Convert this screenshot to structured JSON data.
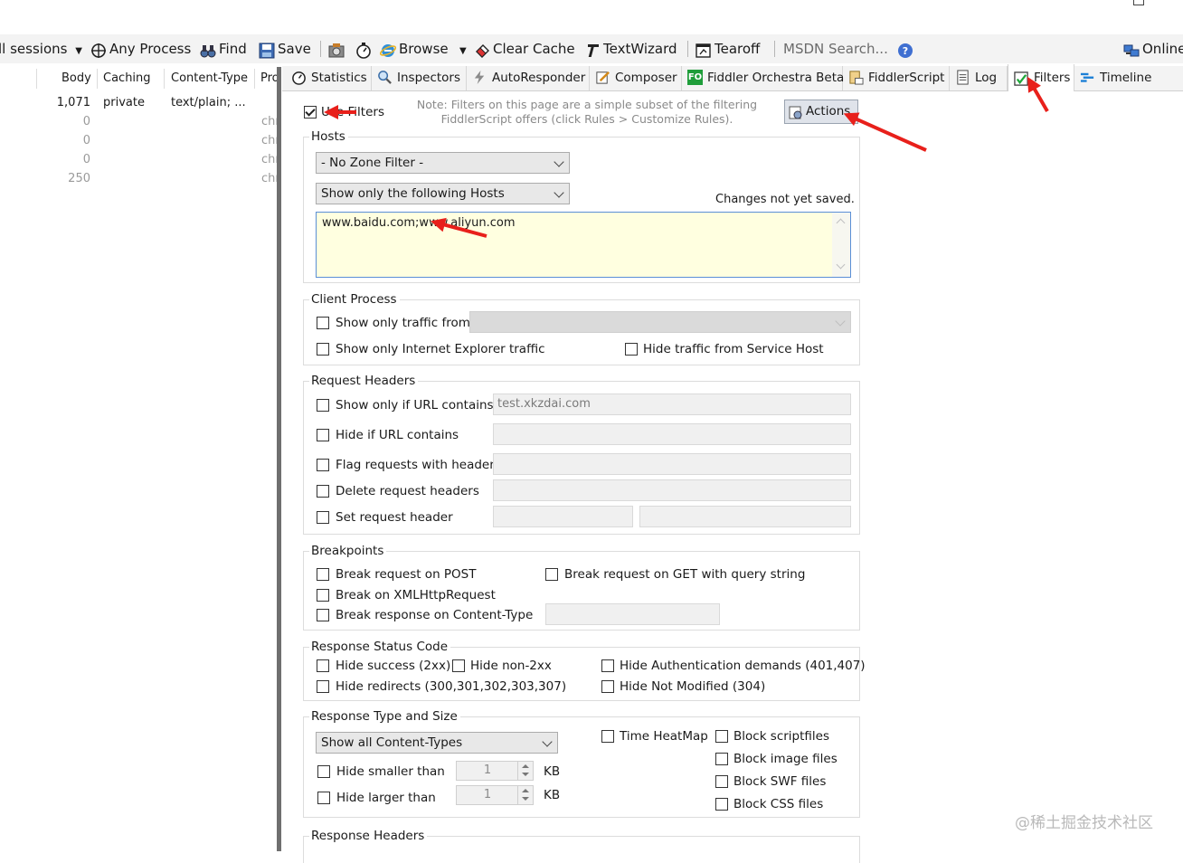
{
  "toolbar": {
    "sessions_label": "ll sessions",
    "any_process": "Any Process",
    "find": "Find",
    "save": "Save",
    "browse": "Browse",
    "clear_cache": "Clear Cache",
    "text_wizard": "TextWizard",
    "tearoff": "Tearoff",
    "msdn_search": "MSDN Search...",
    "online": "Online"
  },
  "sessions": {
    "columns": [
      "Body",
      "Caching",
      "Content-Type",
      "Pro"
    ],
    "rows": [
      {
        "body": "1,071",
        "caching": "private",
        "content_type": "text/plain; ...",
        "process": ""
      },
      {
        "body": "0",
        "caching": "",
        "content_type": "",
        "process": "chr"
      },
      {
        "body": "0",
        "caching": "",
        "content_type": "",
        "process": "chr"
      },
      {
        "body": "0",
        "caching": "",
        "content_type": "",
        "process": "chr"
      },
      {
        "body": "250",
        "caching": "",
        "content_type": "",
        "process": "chr"
      }
    ]
  },
  "tabs": [
    "Statistics",
    "Inspectors",
    "AutoResponder",
    "Composer",
    "Fiddler Orchestra Beta",
    "FiddlerScript",
    "Log",
    "Filters",
    "Timeline"
  ],
  "tab_icon_fo": "FO",
  "filters": {
    "use_filters": "Use Filters",
    "note": "Note: Filters on this page are a simple subset of the filtering FiddlerScript offers (click Rules > Customize Rules).",
    "actions": "Actions",
    "hosts": {
      "title": "Hosts",
      "zone_filter": "- No Zone Filter -",
      "host_mode": "Show only the following Hosts",
      "changes_status": "Changes not yet saved.",
      "host_list": "www.baidu.com;www.aliyun.com"
    },
    "client_process": {
      "title": "Client Process",
      "show_only_from": "Show only traffic from",
      "ie_only": "Show only Internet Explorer traffic",
      "hide_service_host": "Hide traffic from Service Host"
    },
    "request_headers": {
      "title": "Request Headers",
      "url_contains": "Show only if URL contains",
      "url_contains_value": "test.xkzdai.com",
      "hide_url": "Hide if URL contains",
      "flag_headers": "Flag requests with headers",
      "delete_headers": "Delete request headers",
      "set_header": "Set request header"
    },
    "breakpoints": {
      "title": "Breakpoints",
      "post": "Break request on POST",
      "get_query": "Break request on GET with query string",
      "xhr": "Break on XMLHttpRequest",
      "content_type": "Break response on Content-Type"
    },
    "status_code": {
      "title": "Response Status Code",
      "hide_success": "Hide success (2xx)",
      "hide_non2xx": "Hide non-2xx",
      "hide_auth": "Hide Authentication demands (401,407)",
      "hide_redirects": "Hide redirects (300,301,302,303,307)",
      "hide_not_modified": "Hide Not Modified (304)"
    },
    "type_size": {
      "title": "Response Type and Size",
      "content_types": "Show all Content-Types",
      "time_heatmap": "Time HeatMap",
      "block_script": "Block scriptfiles",
      "block_image": "Block image files",
      "block_swf": "Block SWF files",
      "block_css": "Block CSS files",
      "hide_smaller": "Hide smaller than",
      "hide_larger": "Hide larger than",
      "smaller_value": "1",
      "larger_value": "1",
      "unit": "KB"
    },
    "response_headers": {
      "title": "Response Headers"
    }
  },
  "watermark": "@稀土掘金技术社区",
  "colors": {
    "annotation_arrow": "#e8201b",
    "hosts_bg": "#ffffe0",
    "hosts_border": "#5b8fd6"
  }
}
